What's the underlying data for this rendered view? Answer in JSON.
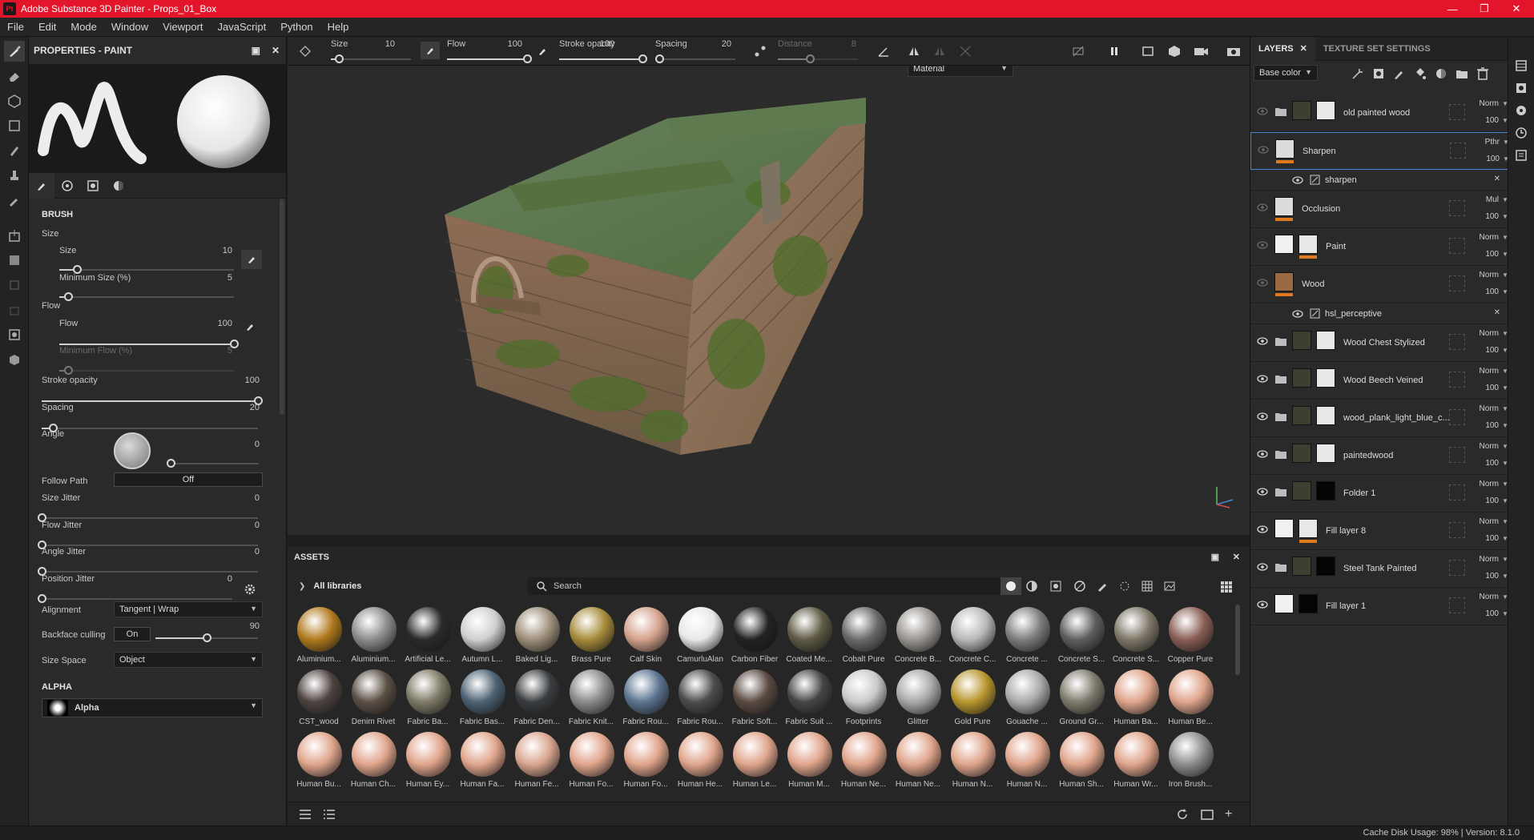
{
  "app": {
    "title": "Adobe Substance 3D Painter - Props_01_Box",
    "logo": "Pt"
  },
  "menu": [
    "File",
    "Edit",
    "Mode",
    "Window",
    "Viewport",
    "JavaScript",
    "Python",
    "Help"
  ],
  "properties": {
    "title": "PROPERTIES - PAINT",
    "brush_section": "BRUSH",
    "size_group": "Size",
    "size_label": "Size",
    "size_value": "10",
    "min_size_label": "Minimum Size (%)",
    "min_size_value": "5",
    "flow_group": "Flow",
    "flow_label": "Flow",
    "flow_value": "100",
    "min_flow_label": "Minimum Flow (%)",
    "min_flow_value": "5",
    "stroke_label": "Stroke opacity",
    "stroke_value": "100",
    "spacing_label": "Spacing",
    "spacing_value": "20",
    "angle_label": "Angle",
    "angle_value": "0",
    "follow_path_label": "Follow Path",
    "follow_path_value": "Off",
    "size_jitter_label": "Size Jitter",
    "size_jitter_value": "0",
    "flow_jitter_label": "Flow Jitter",
    "flow_jitter_value": "0",
    "angle_jitter_label": "Angle Jitter",
    "angle_jitter_value": "0",
    "position_jitter_label": "Position Jitter",
    "position_jitter_value": "0",
    "alignment_label": "Alignment",
    "alignment_value": "Tangent | Wrap",
    "backface_label": "Backface culling",
    "backface_toggle": "On",
    "backface_value": "90",
    "size_space_label": "Size Space",
    "size_space_value": "Object",
    "alpha_section": "ALPHA",
    "alpha_value": "Alpha",
    "levels": {
      "size": 0.1,
      "min_size": 0.05,
      "flow": 1.0,
      "min_flow": 0.05,
      "stroke": 1.0,
      "spacing": 0.05,
      "angle": 0.0,
      "size_jitter": 0.0,
      "flow_jitter": 0.0,
      "angle_jitter": 0.0,
      "position_jitter": 0.0,
      "backface": 0.5
    }
  },
  "toolbar": {
    "size_label": "Size",
    "size_value": "10",
    "flow_label": "Flow",
    "flow_value": "100",
    "stroke_label": "Stroke opacity",
    "stroke_value": "100",
    "spacing_label": "Spacing",
    "spacing_value": "20",
    "distance_label": "Distance",
    "distance_value": "8"
  },
  "viewport": {
    "mode_select": "Material"
  },
  "assets": {
    "title": "ASSETS",
    "library": "All libraries",
    "search_placeholder": "Search",
    "items": [
      {
        "name": "Aluminium...",
        "color": "#b07a1e"
      },
      {
        "name": "Aluminium...",
        "color": "#8c8c8c"
      },
      {
        "name": "Artificial Le...",
        "color": "#2b2b2b"
      },
      {
        "name": "Autumn L...",
        "color": "#cfcfcf"
      },
      {
        "name": "Baked Lig...",
        "color": "#9e8f7a"
      },
      {
        "name": "Brass Pure",
        "color": "#a68c3a"
      },
      {
        "name": "Calf Skin",
        "color": "#d4a28c"
      },
      {
        "name": "CamurluAlan",
        "color": "#e8e8e8"
      },
      {
        "name": "Carbon Fiber",
        "color": "#222222"
      },
      {
        "name": "Coated Me...",
        "color": "#5e5a45"
      },
      {
        "name": "Cobalt Pure",
        "color": "#6a6a6a"
      },
      {
        "name": "Concrete B...",
        "color": "#9a9691"
      },
      {
        "name": "Concrete C...",
        "color": "#b9b9b9"
      },
      {
        "name": "Concrete ...",
        "color": "#7d7d7d"
      },
      {
        "name": "Concrete S...",
        "color": "#5e5e5e"
      },
      {
        "name": "Concrete S...",
        "color": "#7e7868"
      },
      {
        "name": "Copper Pure",
        "color": "#8a5f56"
      },
      {
        "name": "CST_wood",
        "color": "#4d4340"
      },
      {
        "name": "Denim Rivet",
        "color": "#5a4f44"
      },
      {
        "name": "Fabric Ba...",
        "color": "#7e7a66"
      },
      {
        "name": "Fabric Bas...",
        "color": "#4c6273"
      },
      {
        "name": "Fabric Den...",
        "color": "#3a3d40"
      },
      {
        "name": "Fabric Knit...",
        "color": "#8a8a8a"
      },
      {
        "name": "Fabric Rou...",
        "color": "#5b7490"
      },
      {
        "name": "Fabric Rou...",
        "color": "#4c4c4c"
      },
      {
        "name": "Fabric Soft...",
        "color": "#5a4a42"
      },
      {
        "name": "Fabric Suit ...",
        "color": "#454545"
      },
      {
        "name": "Footprints",
        "color": "#c9c9c9"
      },
      {
        "name": "Glitter",
        "color": "#a8a8a8"
      },
      {
        "name": "Gold Pure",
        "color": "#b8962e"
      },
      {
        "name": "Gouache ...",
        "color": "#a9a9a9"
      },
      {
        "name": "Ground Gr...",
        "color": "#7e7a6c"
      },
      {
        "name": "Human Ba...",
        "color": "#e0a58c"
      },
      {
        "name": "Human Be...",
        "color": "#e0a58c"
      },
      {
        "name": "Human Bu...",
        "color": "#e0a58c"
      },
      {
        "name": "Human Ch...",
        "color": "#e0a58c"
      },
      {
        "name": "Human Ey...",
        "color": "#e0a58c"
      },
      {
        "name": "Human Fa...",
        "color": "#e0a58c"
      },
      {
        "name": "Human Fe...",
        "color": "#d9a58f"
      },
      {
        "name": "Human Fo...",
        "color": "#e0a58c"
      },
      {
        "name": "Human Fo...",
        "color": "#e0a58c"
      },
      {
        "name": "Human He...",
        "color": "#e0a58c"
      },
      {
        "name": "Human Le...",
        "color": "#e0a58c"
      },
      {
        "name": "Human M...",
        "color": "#e0a58c"
      },
      {
        "name": "Human Ne...",
        "color": "#e0a58c"
      },
      {
        "name": "Human Ne...",
        "color": "#e0a58c"
      },
      {
        "name": "Human N...",
        "color": "#e0a58c"
      },
      {
        "name": "Human N...",
        "color": "#e0a58c"
      },
      {
        "name": "Human Sh...",
        "color": "#e0a58c"
      },
      {
        "name": "Human Wr...",
        "color": "#e0a58c"
      },
      {
        "name": "Iron Brush...",
        "color": "#8c8c8c"
      }
    ]
  },
  "layers": {
    "tab_layers": "LAYERS",
    "tab_texture": "TEXTURE SET SETTINGS",
    "channel": "Base color",
    "rows": [
      {
        "name": "old painted wood",
        "type": "folder",
        "blend": "Norm",
        "opacity": "100",
        "visible": false
      },
      {
        "name": "Sharpen",
        "type": "filter",
        "blend": "Pthr",
        "opacity": "100",
        "visible": false,
        "selected": true
      },
      {
        "name": "sharpen",
        "type": "effect"
      },
      {
        "name": "Occlusion",
        "type": "filter",
        "blend": "Mul",
        "opacity": "100",
        "visible": false
      },
      {
        "name": "Paint",
        "type": "fill",
        "blend": "Norm",
        "opacity": "100",
        "visible": false
      },
      {
        "name": "Wood",
        "type": "fill",
        "blend": "Norm",
        "opacity": "100",
        "visible": false
      },
      {
        "name": "hsl_perceptive",
        "type": "effect"
      },
      {
        "name": "Wood Chest Stylized",
        "type": "folder",
        "blend": "Norm",
        "opacity": "100",
        "visible": true
      },
      {
        "name": "Wood Beech Veined",
        "type": "folder",
        "blend": "Norm",
        "opacity": "100",
        "visible": true
      },
      {
        "name": "wood_plank_light_blue_c...",
        "type": "folder",
        "blend": "Norm",
        "opacity": "100",
        "visible": true
      },
      {
        "name": "paintedwood",
        "type": "folder",
        "blend": "Norm",
        "opacity": "100",
        "visible": true
      },
      {
        "name": "Folder 1",
        "type": "folder",
        "blend": "Norm",
        "opacity": "100",
        "visible": true
      },
      {
        "name": "Fill layer 8",
        "type": "fill",
        "blend": "Norm",
        "opacity": "100",
        "visible": true
      },
      {
        "name": "Steel Tank Painted",
        "type": "folder",
        "blend": "Norm",
        "opacity": "100",
        "visible": true
      },
      {
        "name": "Fill layer 1",
        "type": "fill",
        "blend": "Norm",
        "opacity": "100",
        "visible": true
      }
    ]
  },
  "status": {
    "text": "Cache Disk Usage:  98% | Version: 8.1.0"
  },
  "colors": {
    "title_bar": "#e3152b",
    "accent_blue": "#4a88d8",
    "mask_orange": "#e07a1f"
  }
}
